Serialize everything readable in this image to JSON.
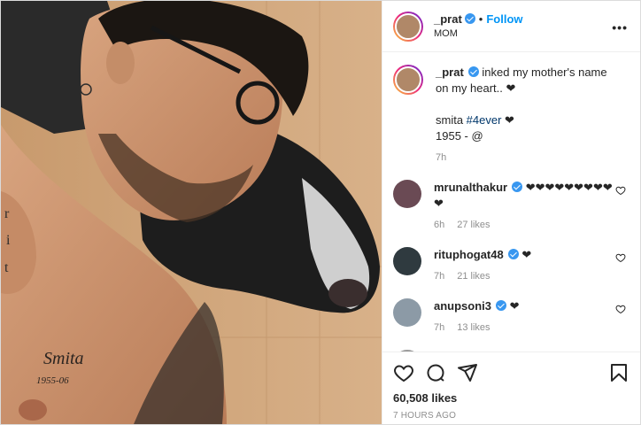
{
  "header": {
    "username": "_prat",
    "dot": "•",
    "follow_label": "Follow",
    "location": "MOM",
    "more_icon": "more-horizontal-icon"
  },
  "caption": {
    "username": "_prat",
    "text_line1": " inked my mother's name on my heart.. ❤",
    "text_line2_prefix": "smita ",
    "hashtag": "#4ever",
    "text_line2_suffix": " ❤",
    "text_line3": "1955 - @",
    "age": "7h"
  },
  "comments": [
    {
      "username": "mrunalthakur",
      "text": " ❤❤❤❤❤❤❤❤❤❤",
      "age": "6h",
      "likes": "27 likes"
    },
    {
      "username": "rituphogat48",
      "text": " ❤",
      "age": "7h",
      "likes": "21 likes"
    },
    {
      "username": "anupsoni3",
      "text": " ❤",
      "age": "7h",
      "likes": "13 likes"
    }
  ],
  "footer": {
    "likes": "60,508 likes",
    "timestamp": "7 HOURS AGO"
  },
  "colors": {
    "link_blue": "#0095f6",
    "verified_blue": "#3897f0",
    "hashtag": "#00376b",
    "muted": "#8e8e8e"
  }
}
